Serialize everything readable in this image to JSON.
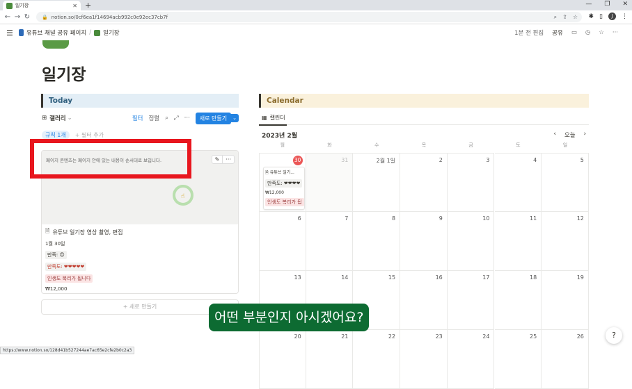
{
  "browser": {
    "tab_title": "일기장",
    "tab_close": "✕",
    "new_tab": "+",
    "window_controls": [
      "—",
      "❐",
      "✕"
    ],
    "back": "←",
    "forward": "→",
    "reload": "↻",
    "url": "notion.so/0cf6ea1f14694acb992c0e92ec37cb7f",
    "omni_icons": [
      "search-icon",
      "share-icon",
      "star-icon"
    ],
    "profile_initial": "J",
    "status_url": "https://www.notion.so/128d41b527244ae7ac65e2cfe2b0c2a3"
  },
  "topbar": {
    "menu_icon": "☰",
    "crumb1": "유튜브 채널 공유 페이지",
    "separator": "/",
    "crumb2": "일기장",
    "edited": "1분 전 편집",
    "share": "공유"
  },
  "page": {
    "title": "일기장"
  },
  "today": {
    "heading": "Today",
    "view_label": "갤러리",
    "filter": "필터",
    "sort": "정렬",
    "more": "···",
    "new_button": "새로 만들기",
    "rule_chip": "규칙 1개",
    "add_filter": "필터 추가",
    "preview_text": "페이지 콘텐츠는 페이지 안에 있는 내용이 순서대로 보입니다.",
    "card": {
      "title": "유튜브 일기장 영상 촬영, 편집",
      "date": "1월 30일",
      "satisfaction_label": "만족: 😍",
      "rating_label": "만족도: ❤❤❤❤❤",
      "quote": "인생도 복리가 됩니다",
      "amount": "₩12,000"
    },
    "new_card": "+ 새로 만들기"
  },
  "calendar": {
    "heading": "Calendar",
    "view_label": "캘린더",
    "month": "2023년 2월",
    "today_button": "오늘",
    "prev": "‹",
    "next": "›",
    "weekdays": [
      "일",
      "월",
      "화",
      "수",
      "목",
      "금",
      "토",
      "일"
    ],
    "days": [
      "30",
      "31",
      "2월 1일",
      "2",
      "3",
      "4",
      "5",
      "6",
      "7",
      "8",
      "9",
      "10",
      "11",
      "12",
      "13",
      "14",
      "15",
      "16",
      "17",
      "18",
      "19",
      "20",
      "21",
      "22",
      "23",
      "24",
      "25",
      "26"
    ],
    "event": {
      "title": "유튜브 일기...",
      "rating": "만족도: ❤❤❤❤",
      "amount": "₩12,000",
      "quote": "인생도 복리가 됩",
      "satisfaction": "만족: 😍"
    }
  },
  "overlay": {
    "subtitle": "어떤 부분인지 아시겠어요?",
    "help": "?"
  },
  "colors": {
    "highlight_box": "#e8161e",
    "subtitle_bg": "#0d6b32",
    "accent_blue": "#2383e2",
    "today_red": "#eb5757"
  }
}
